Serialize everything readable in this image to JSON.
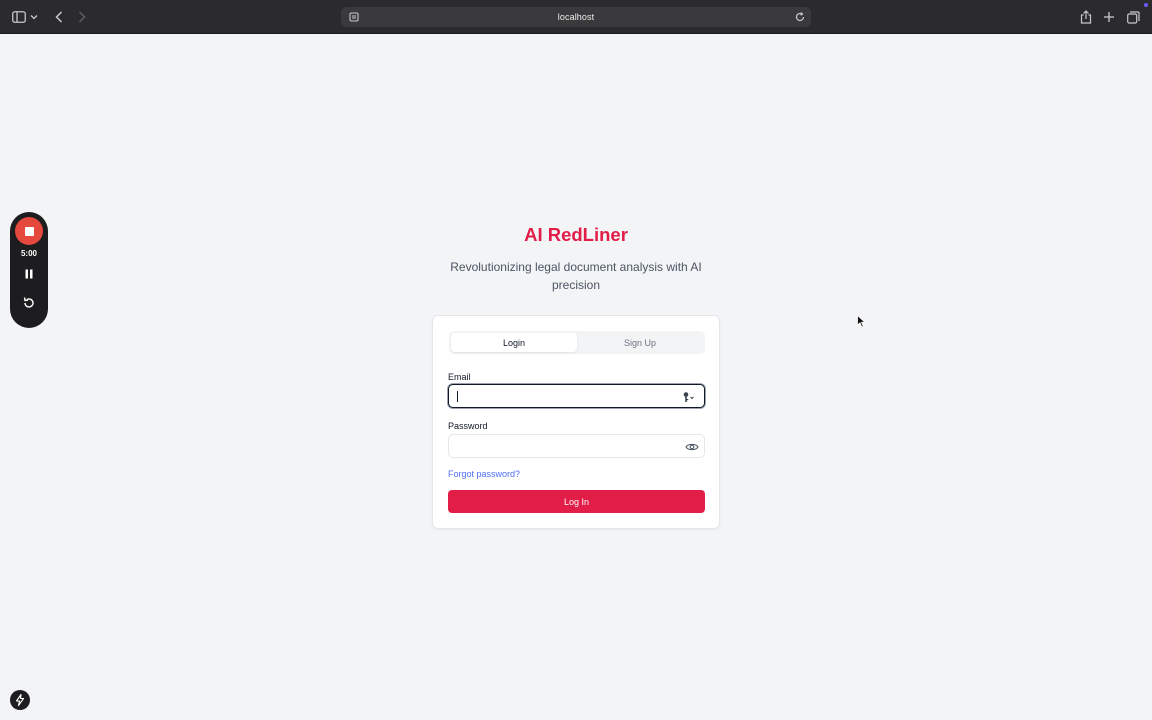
{
  "browser": {
    "url": "localhost"
  },
  "recorder": {
    "time": "5:00"
  },
  "app": {
    "title": "AI RedLiner",
    "subtitle": "Revolutionizing legal document analysis with AI precision"
  },
  "auth": {
    "tabs": [
      {
        "label": "Login",
        "active": true
      },
      {
        "label": "Sign Up",
        "active": false
      }
    ],
    "email_label": "Email",
    "email_value": "",
    "password_label": "Password",
    "password_value": "",
    "forgot_label": "Forgot password?",
    "submit_label": "Log In"
  },
  "colors": {
    "brand": "#e11d48",
    "link": "#4f6ef7",
    "background": "#f3f4f6"
  },
  "icons": [
    "sidebar-icon",
    "chevron-down-icon",
    "back-icon",
    "forward-icon",
    "site-settings-icon",
    "reload-icon",
    "share-icon",
    "new-tab-icon",
    "tabs-overview-icon",
    "stop-icon",
    "pause-icon",
    "restart-icon",
    "key-icon",
    "eye-icon",
    "bolt-icon"
  ]
}
